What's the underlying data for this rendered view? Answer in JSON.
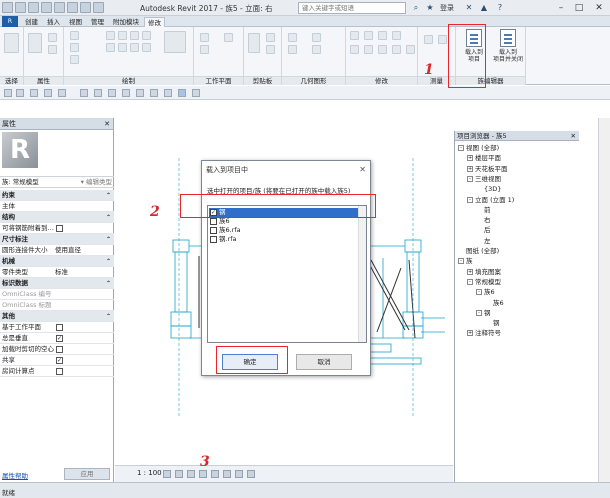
{
  "titlebar": {
    "app_title": "Autodesk Revit 2017 -   族5 - 立面: 右",
    "search_placeholder": "键入关键字或短语",
    "login": "登录",
    "help": "?"
  },
  "ribbon_tabs": [
    "创建",
    "插入",
    "视图",
    "管理",
    "附加模块",
    "修改"
  ],
  "ribbon_groups": {
    "select": "选择",
    "properties": "属性",
    "draw": "绘制",
    "work_plane": "工作平面",
    "clipboard": "剪贴板",
    "geometry": "几何图形",
    "modify": "修改",
    "measure": "测量",
    "family_editor": "族编辑器"
  },
  "ribbon_buttons": {
    "load_into_project": "载入到\n项目",
    "load_into_project_close": "载入到\n项目并关闭"
  },
  "properties": {
    "header": "属性",
    "type_selector": "族: 常规模型",
    "edit_type": "编辑类型",
    "rows": [
      {
        "kind": "cat",
        "label": "约束"
      },
      {
        "kind": "row",
        "label": "主体",
        "value": ""
      },
      {
        "kind": "cat",
        "label": "结构"
      },
      {
        "kind": "check",
        "label": "可将钢筋附着到…",
        "checked": false
      },
      {
        "kind": "cat",
        "label": "尺寸标注"
      },
      {
        "kind": "row",
        "label": "圆形连接件大小",
        "value": "使用直径"
      },
      {
        "kind": "cat",
        "label": "机械"
      },
      {
        "kind": "row",
        "label": "零件类型",
        "value": "标准"
      },
      {
        "kind": "cat",
        "label": "标识数据"
      },
      {
        "kind": "row",
        "label": "OmniClass 编号",
        "value": "",
        "grey": true
      },
      {
        "kind": "row",
        "label": "OmniClass 标题",
        "value": "",
        "grey": true
      },
      {
        "kind": "cat",
        "label": "其他"
      },
      {
        "kind": "check",
        "label": "基于工作平面",
        "checked": false
      },
      {
        "kind": "check",
        "label": "总是垂直",
        "checked": true
      },
      {
        "kind": "check",
        "label": "加载时剪切的空心",
        "checked": false
      },
      {
        "kind": "check",
        "label": "共享",
        "checked": true
      },
      {
        "kind": "check",
        "label": "房间计算点",
        "checked": false
      }
    ],
    "help_link": "属性帮助",
    "apply": "应用"
  },
  "browser": {
    "header": "项目浏览器 - 族5",
    "nodes": [
      {
        "level": 0,
        "toggle": "-",
        "label": "视图 (全部)"
      },
      {
        "level": 1,
        "toggle": "+",
        "label": "楼层平面"
      },
      {
        "level": 1,
        "toggle": "+",
        "label": "天花板平面"
      },
      {
        "level": 1,
        "toggle": "-",
        "label": "三维视图"
      },
      {
        "level": 2,
        "toggle": "",
        "label": "{3D}"
      },
      {
        "level": 1,
        "toggle": "-",
        "label": "立面 (立面 1)"
      },
      {
        "level": 2,
        "toggle": "",
        "label": "前"
      },
      {
        "level": 2,
        "toggle": "",
        "label": "右"
      },
      {
        "level": 2,
        "toggle": "",
        "label": "后"
      },
      {
        "level": 2,
        "toggle": "",
        "label": "左"
      },
      {
        "level": 0,
        "toggle": "",
        "label": "图纸 (全部)"
      },
      {
        "level": 0,
        "toggle": "-",
        "label": "族"
      },
      {
        "level": 1,
        "toggle": "+",
        "label": "填充图案"
      },
      {
        "level": 1,
        "toggle": "-",
        "label": "常规模型"
      },
      {
        "level": 2,
        "toggle": "-",
        "label": "族6"
      },
      {
        "level": 3,
        "toggle": "",
        "label": "族6"
      },
      {
        "level": 2,
        "toggle": "-",
        "label": "钢"
      },
      {
        "level": 3,
        "toggle": "",
        "label": "钢"
      },
      {
        "level": 1,
        "toggle": "+",
        "label": "注释符号"
      }
    ]
  },
  "viewbar": {
    "scale": "1 : 100"
  },
  "statusbar": {
    "text": "就绪"
  },
  "dialog": {
    "title": "载入到项目中",
    "close": "✕",
    "prompt": "选中打开的项目/族 (将要在已打开的族中载入族5)",
    "items": [
      {
        "label": "钢",
        "checked": true,
        "selected": true
      },
      {
        "label": "族6",
        "checked": false,
        "selected": false
      },
      {
        "label": "族6.rfa",
        "checked": false,
        "selected": false
      },
      {
        "label": "钢.rfa",
        "checked": false,
        "selected": false
      }
    ],
    "ok": "确定",
    "cancel": "取消"
  },
  "annotations": {
    "n1": "1",
    "n2": "2",
    "n3": "3"
  },
  "colors": {
    "accent": "#2f6ec9",
    "annotation": "#e8262b",
    "geometry": "#1aa3c8"
  }
}
